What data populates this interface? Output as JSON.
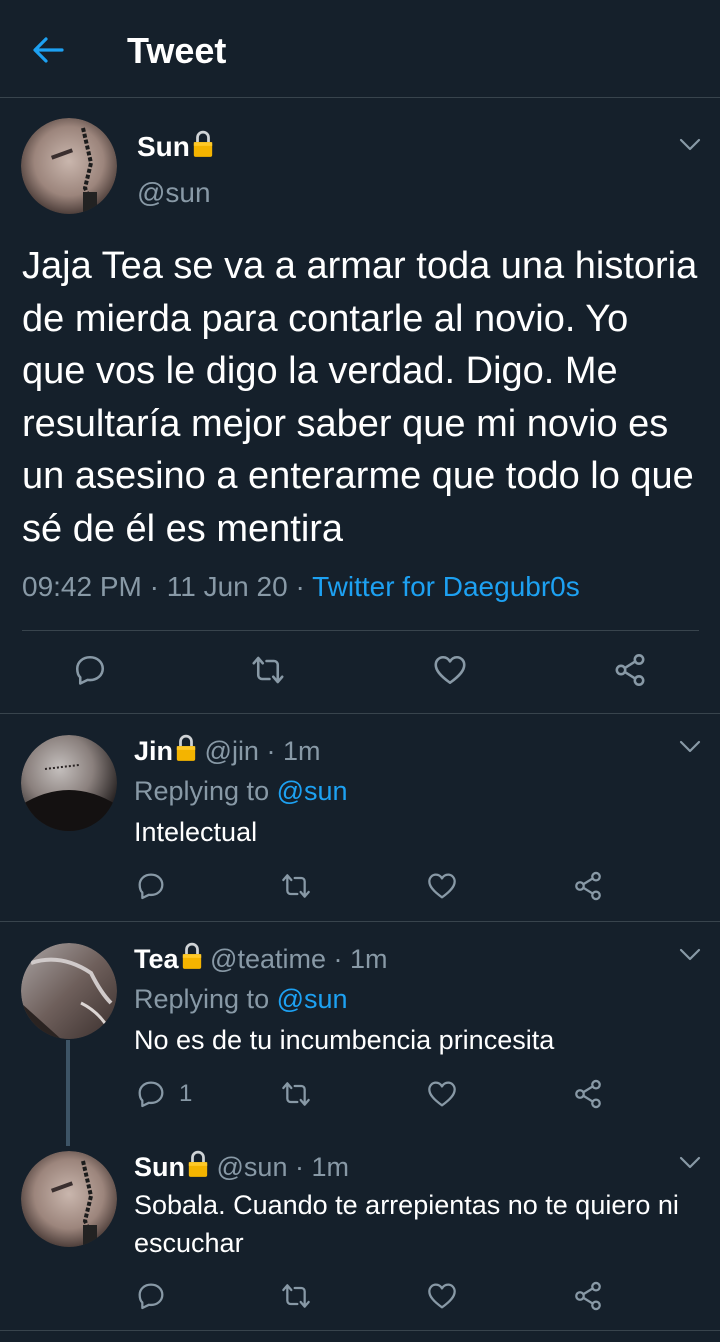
{
  "header": {
    "title": "Tweet"
  },
  "main_tweet": {
    "display_name": "Sun",
    "handle": "@sun",
    "text": "Jaja Tea se va a armar toda una historia de mierda para contarle al novio. Yo que vos le digo la verdad. Digo. Me resultaría mejor saber que mi novio es un asesino a enterarme que todo lo que sé de él es mentira",
    "time": "09:42 PM",
    "sep1": "·",
    "date": "11 Jun 20",
    "sep2": "·",
    "source": "Twitter for Daegubr0s"
  },
  "replies": [
    {
      "display_name": "Jin",
      "handle": "@jin",
      "sep": "·",
      "time": "1m",
      "replying_label": "Replying to",
      "replying_handle": "@sun",
      "text": "Intelectual",
      "reply_count": ""
    },
    {
      "display_name": "Tea",
      "handle": "@teatime",
      "sep": "·",
      "time": "1m",
      "replying_label": "Replying to",
      "replying_handle": "@sun",
      "text": "No es de tu incumbencia princesita",
      "reply_count": "1"
    },
    {
      "display_name": "Sun",
      "handle": "@sun",
      "sep": "·",
      "time": "1m",
      "text": "Sobala. Cuando te arrepientas no te quiero ni escuchar",
      "reply_count": ""
    }
  ],
  "icons": [
    "back-arrow-icon",
    "lock-icon",
    "chevron-down-icon",
    "reply-icon",
    "retweet-icon",
    "like-icon",
    "share-icon"
  ],
  "colors": {
    "background": "#15202b",
    "accent": "#1da1f2",
    "muted": "#8899a6",
    "lock": "#f4b400",
    "divider": "#38444d"
  }
}
